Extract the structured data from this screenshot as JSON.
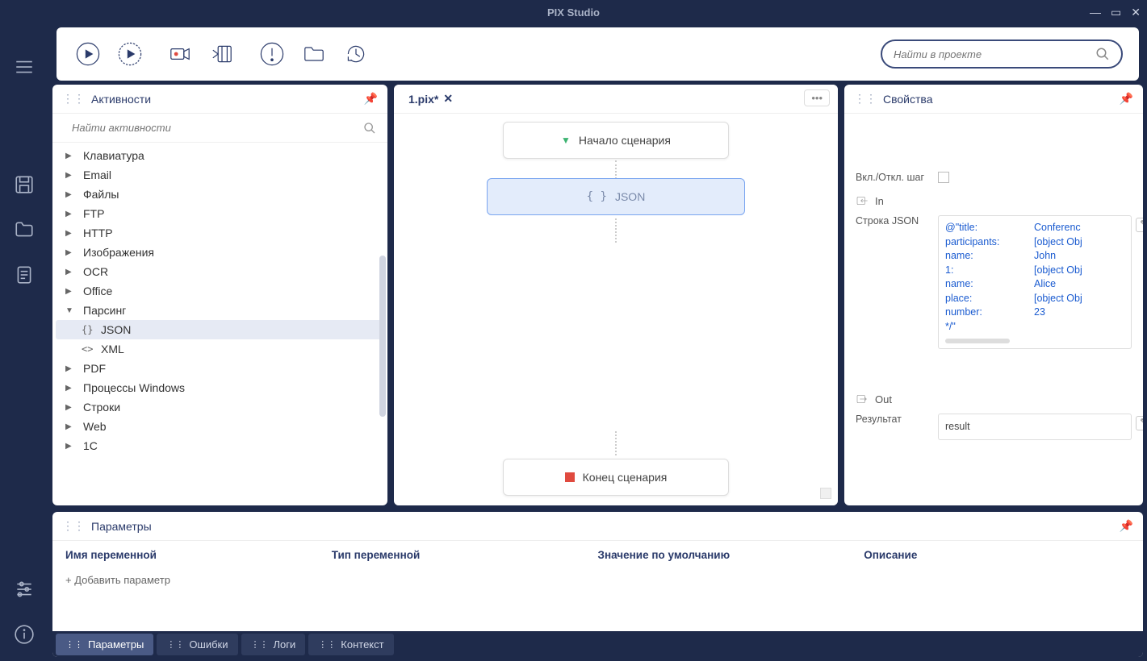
{
  "app": {
    "title": "PIX Studio"
  },
  "toolbar": {
    "search_placeholder": "Найти в проекте"
  },
  "activities": {
    "title": "Активности",
    "search_placeholder": "Найти активности",
    "items": [
      {
        "label": "Клавиатура",
        "expanded": false
      },
      {
        "label": "Email",
        "expanded": false
      },
      {
        "label": "Файлы",
        "expanded": false
      },
      {
        "label": "FTP",
        "expanded": false
      },
      {
        "label": "HTTP",
        "expanded": false
      },
      {
        "label": "Изображения",
        "expanded": false
      },
      {
        "label": "OCR",
        "expanded": false
      },
      {
        "label": "Office",
        "expanded": false
      },
      {
        "label": "Парсинг",
        "expanded": true,
        "children": [
          {
            "label": "JSON",
            "icon": "{}",
            "selected": true
          },
          {
            "label": "XML",
            "icon": "<>"
          }
        ]
      },
      {
        "label": "PDF",
        "expanded": false
      },
      {
        "label": "Процессы Windows",
        "expanded": false
      },
      {
        "label": "Строки",
        "expanded": false
      },
      {
        "label": "Web",
        "expanded": false
      },
      {
        "label": "1С",
        "expanded": false
      }
    ]
  },
  "tabs": {
    "active": "1.pix*"
  },
  "canvas": {
    "start_label": "Начало сценария",
    "json_label": "JSON",
    "end_label": "Конец сценария"
  },
  "properties": {
    "title": "Свойства",
    "toggle_label": "Вкл./Откл. шаг",
    "in_label": "In",
    "out_label": "Out",
    "json_field_label": "Строка JSON",
    "result_field_label": "Результат",
    "result_value": "result",
    "json_code": [
      [
        "@\"title:",
        "Conferenc"
      ],
      [
        "participants:",
        "[object Obj"
      ],
      [
        "name:",
        "John"
      ],
      [
        "1:",
        "[object Obj"
      ],
      [
        "name:",
        "Alice"
      ],
      [
        "place:",
        "[object Obj"
      ],
      [
        "number:",
        "23"
      ],
      [
        "*/\"",
        ""
      ]
    ]
  },
  "parameters": {
    "title": "Параметры",
    "columns": {
      "name": "Имя переменной",
      "type": "Тип переменной",
      "default": "Значение по умолчанию",
      "desc": "Описание"
    },
    "add_label": "+ Добавить параметр"
  },
  "bottom_tabs": [
    {
      "label": "Параметры",
      "active": true
    },
    {
      "label": "Ошибки"
    },
    {
      "label": "Логи"
    },
    {
      "label": "Контекст"
    }
  ]
}
